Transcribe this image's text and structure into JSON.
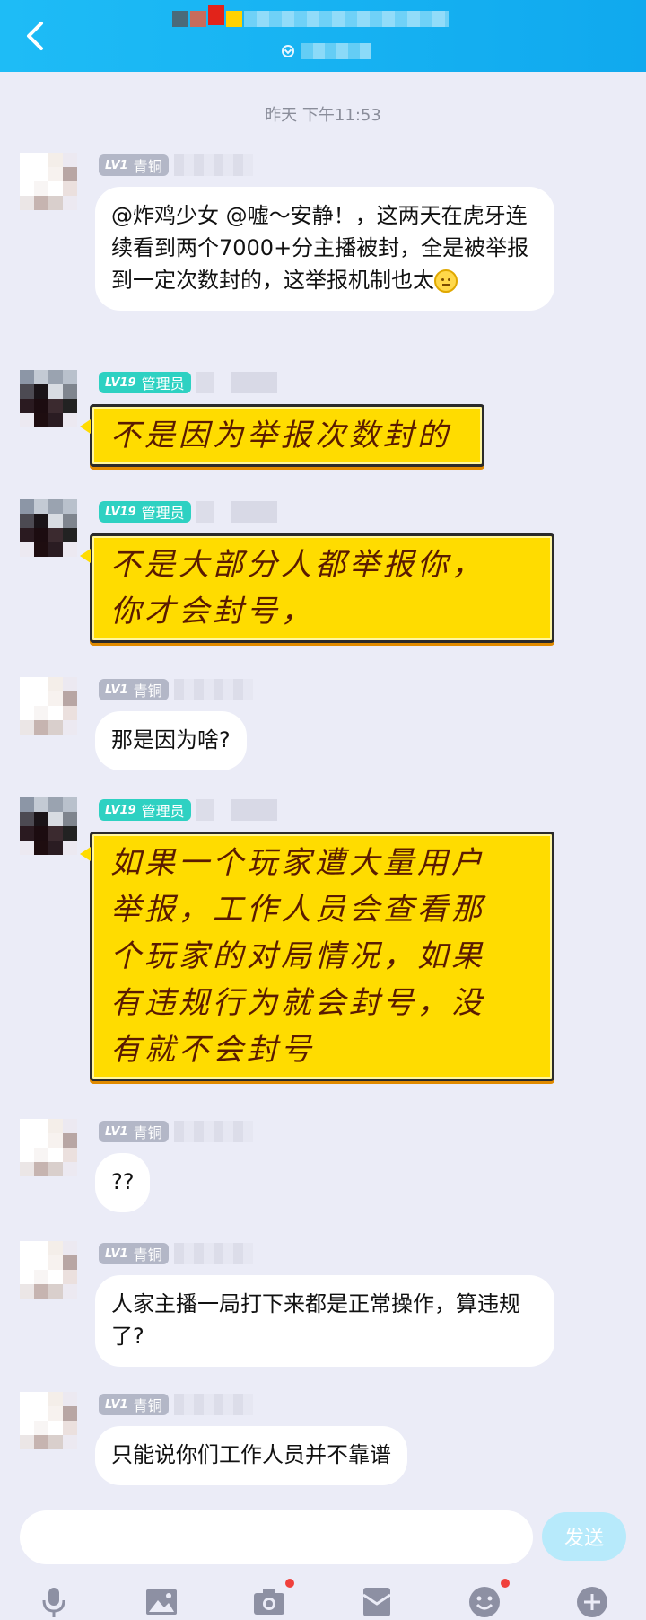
{
  "header": {
    "back_icon": "chevron-left-icon",
    "colors": {
      "gradient_start": "#1ebcf6",
      "gradient_end": "#10a9ee"
    }
  },
  "timestamp": "昨天 下午11:53",
  "badges": {
    "bronze": {
      "level": "LV1",
      "title": "青铜"
    },
    "admin": {
      "level": "LV19",
      "title": "管理员"
    }
  },
  "messages": [
    {
      "role": "user",
      "text": "@炸鸡少女 @嘘～安静！，这两天在虎牙连续看到两个7000+分主播被封，全是被举报到一定次数封的，这举报机制也太",
      "emoji": "smile-emoji"
    },
    {
      "role": "admin",
      "lines": [
        "不是因为举报次数封的"
      ]
    },
    {
      "role": "admin",
      "lines": [
        "不是大部分人都举报你，",
        "你才会封号，"
      ]
    },
    {
      "role": "user",
      "text": "那是因为啥?"
    },
    {
      "role": "admin",
      "lines": [
        "如果一个玩家遭大量用户",
        "举报，工作人员会查看那",
        "个玩家的对局情况，如果",
        "有违规行为就会封号，没",
        "有就不会封号"
      ]
    },
    {
      "role": "user",
      "text": "??"
    },
    {
      "role": "user",
      "text": "人家主播一局打下来都是正常操作，算违规了?"
    },
    {
      "role": "user",
      "text": "只能说你们工作人员并不靠谱"
    }
  ],
  "input": {
    "placeholder": "",
    "send_label": "发送"
  },
  "toolbar": [
    "microphone-icon",
    "image-icon",
    "camera-icon",
    "red-packet-icon",
    "emoji-icon",
    "plus-icon"
  ]
}
